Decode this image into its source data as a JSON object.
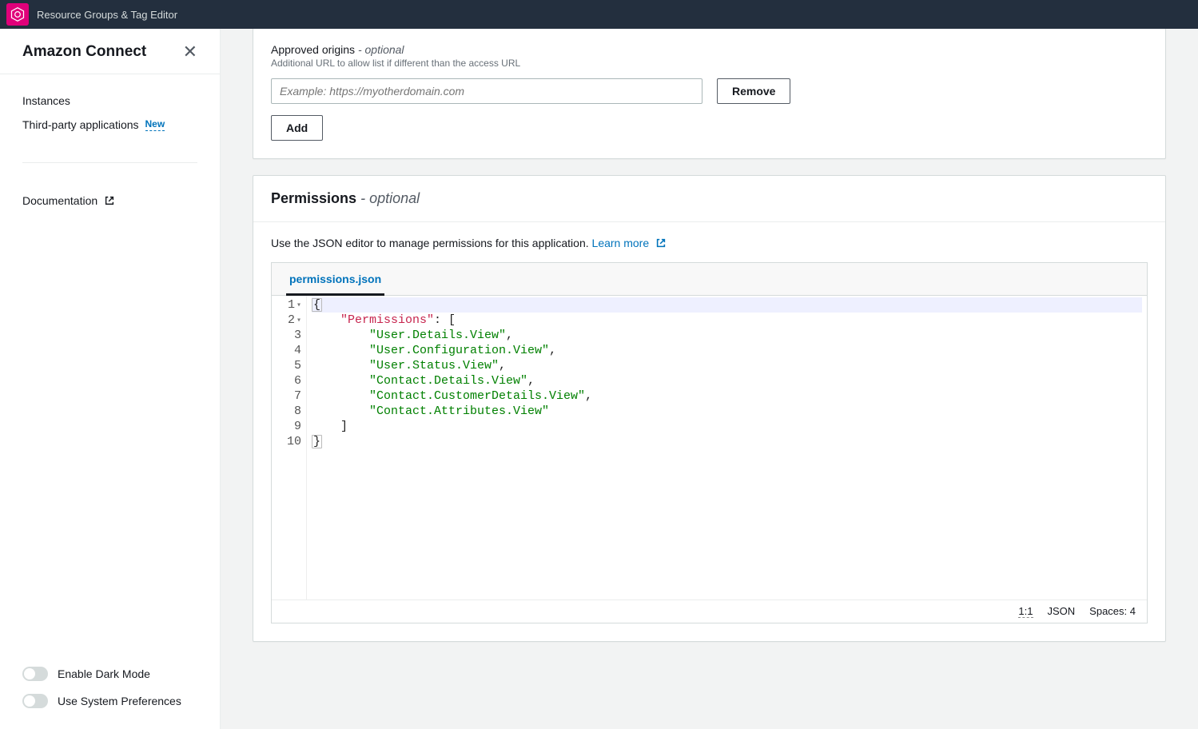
{
  "topbar": {
    "title": "Resource Groups & Tag Editor"
  },
  "sidebar": {
    "title": "Amazon Connect",
    "items": [
      {
        "label": "Instances",
        "badge": ""
      },
      {
        "label": "Third-party applications",
        "badge": "New"
      }
    ],
    "doc_label": "Documentation",
    "toggles": {
      "dark_label": "Enable Dark Mode",
      "system_label": "Use System Preferences"
    }
  },
  "origins": {
    "title": "Approved origins",
    "optional_suffix": "- optional",
    "subtitle": "Additional URL to allow list if different than the access URL",
    "placeholder": "Example: https://myotherdomain.com",
    "remove_label": "Remove",
    "add_label": "Add"
  },
  "permissions": {
    "title": "Permissions",
    "optional_suffix": "- optional",
    "description": "Use the JSON editor to manage permissions for this application.",
    "learn_more": "Learn more",
    "tab_label": "permissions.json",
    "code_lines": [
      {
        "n": 1,
        "fold": true,
        "tokens": [
          [
            "punc",
            "{"
          ]
        ],
        "highlight": true,
        "box_first": true
      },
      {
        "n": 2,
        "fold": true,
        "tokens": [
          [
            "pad",
            "    "
          ],
          [
            "key",
            "\"Permissions\""
          ],
          [
            "punc",
            ": ["
          ]
        ]
      },
      {
        "n": 3,
        "tokens": [
          [
            "pad",
            "        "
          ],
          [
            "str",
            "\"User.Details.View\""
          ],
          [
            "punc",
            ","
          ]
        ]
      },
      {
        "n": 4,
        "tokens": [
          [
            "pad",
            "        "
          ],
          [
            "str",
            "\"User.Configuration.View\""
          ],
          [
            "punc",
            ","
          ]
        ]
      },
      {
        "n": 5,
        "tokens": [
          [
            "pad",
            "        "
          ],
          [
            "str",
            "\"User.Status.View\""
          ],
          [
            "punc",
            ","
          ]
        ]
      },
      {
        "n": 6,
        "tokens": [
          [
            "pad",
            "        "
          ],
          [
            "str",
            "\"Contact.Details.View\""
          ],
          [
            "punc",
            ","
          ]
        ]
      },
      {
        "n": 7,
        "tokens": [
          [
            "pad",
            "        "
          ],
          [
            "str",
            "\"Contact.CustomerDetails.View\""
          ],
          [
            "punc",
            ","
          ]
        ]
      },
      {
        "n": 8,
        "tokens": [
          [
            "pad",
            "        "
          ],
          [
            "str",
            "\"Contact.Attributes.View\""
          ]
        ]
      },
      {
        "n": 9,
        "tokens": [
          [
            "pad",
            "    "
          ],
          [
            "punc",
            "]"
          ]
        ]
      },
      {
        "n": 10,
        "tokens": [
          [
            "punc",
            "}"
          ]
        ],
        "box_first": true
      }
    ],
    "status": {
      "pos": "1:1",
      "lang": "JSON",
      "spaces": "Spaces: 4"
    }
  }
}
